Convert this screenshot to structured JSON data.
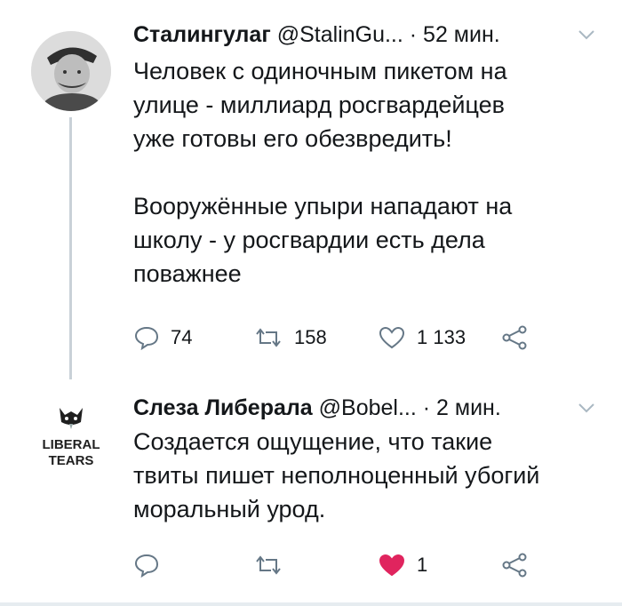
{
  "tweets": [
    {
      "author_name": "Сталингулаг",
      "handle": "@StalinGu...",
      "separator": "·",
      "time": "52 мин.",
      "text_lines": [
        "Человек с одиночным пикетом на",
        "улице - миллиард росгвардейцев",
        "уже готовы его обезвредить!",
        "",
        "Вооружённые упыри нападают на",
        "школу - у росгвардии есть дела",
        "поважнее"
      ],
      "reply_count": "74",
      "retweet_count": "158",
      "like_count": "1 133",
      "liked": false
    },
    {
      "author_name": "Слеза Либерала",
      "handle": "@Bobel...",
      "separator": "·",
      "time": "2 мин.",
      "avatar_logo_text": [
        "LIBERAL",
        "TEARS"
      ],
      "text_lines": [
        "Создается ощущение, что такие",
        "твиты пишет неполноценный убогий",
        "моральный урод."
      ],
      "reply_count": "",
      "retweet_count": "",
      "like_count": "1",
      "liked": true
    }
  ],
  "colors": {
    "text": "#14171a",
    "icon": "#657786",
    "like_active": "#e0245e",
    "thread_line": "#c9d1d8"
  },
  "icons": [
    "reply-icon",
    "retweet-icon",
    "like-icon",
    "share-icon",
    "chevron-down-icon"
  ]
}
